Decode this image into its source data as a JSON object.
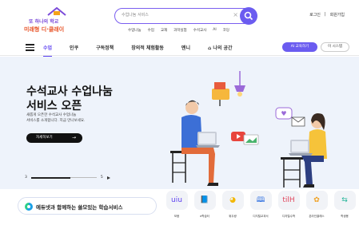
{
  "logo": {
    "line1": "또 하나의 학교",
    "line2": "미래형 디·클래이"
  },
  "search": {
    "placeholder": "수업나눔 서비스",
    "clear_icon": "x-icon",
    "button_icon": "search-icon"
  },
  "keywords": [
    "수업나눔",
    "수업",
    "교재",
    "과학실험",
    "수석교사",
    "AI",
    "코딩"
  ],
  "top_links": {
    "login": "로그인",
    "signup": "회원가입"
  },
  "nav": {
    "items": [
      {
        "label": "수업",
        "active": true
      },
      {
        "label": "인쿠",
        "active": false
      },
      {
        "label": "구독정책",
        "active": false
      },
      {
        "label": "창의적 체험활동",
        "active": false
      },
      {
        "label": "멘니",
        "active": false
      },
      {
        "label": "나의 공간",
        "active": false
      }
    ],
    "button_primary": "AI 교육하기",
    "button_secondary": "이 시스템"
  },
  "hero": {
    "title_line1": "수석교사 수업나눔",
    "title_line2": "서비스 오픈",
    "sub_line1": "새롭게 오픈한 수석교사 수업나눔",
    "sub_line2": "서비스를 소개합니다. 지금 만나보세요.",
    "button_label": "자세히보기",
    "pager": {
      "current": "3",
      "total": "5",
      "progress": 0.6
    }
  },
  "tagline": {
    "brand_icon": "edu-net-logo-icon",
    "text": "에듀넷과 함께하는 쓸모있는 학습서비스"
  },
  "services": [
    {
      "label": "모음",
      "icon": "uiu",
      "color": "#5b3ff0"
    },
    {
      "label": "e학습터",
      "icon": "📘",
      "color": "#1aa0e6"
    },
    {
      "label": "위두랑",
      "icon": "◕",
      "color": "#f2b705"
    },
    {
      "label": "디지털교과서",
      "icon": "🕮",
      "color": "#2b6de0"
    },
    {
      "label": "디지털수학",
      "icon": "tilH",
      "color": "#e0445a"
    },
    {
      "label": "온라인클래스",
      "icon": "✿",
      "color": "#f0a020"
    },
    {
      "label": "학생용",
      "icon": "⇆",
      "color": "#27b59a"
    }
  ],
  "colors": {
    "accent": "#6b5cf0",
    "hero_bg": "#eef3fb"
  }
}
